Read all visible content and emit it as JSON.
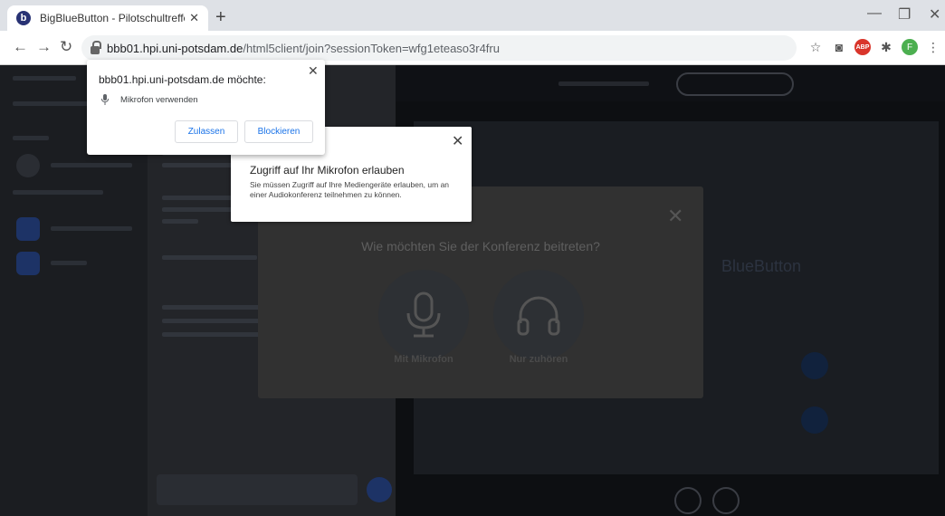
{
  "browser": {
    "tab_title": "BigBlueButton - Pilotschultreffen",
    "tab_favicon": "b",
    "url_host": "bbb01.hpi.uni-potsdam.de",
    "url_path": "/html5client/join?sessionToken=wfg1eteaso3r4fru",
    "profile_initial": "F",
    "abp_label": "ABP",
    "icons": [
      "back-icon",
      "forward-icon",
      "reload-icon",
      "lock-icon",
      "star-icon",
      "camera-icon",
      "adblock-icon",
      "puzzle-icon",
      "profile-icon",
      "menu-icon",
      "minimize-icon",
      "restore-icon",
      "close-icon"
    ]
  },
  "permission_prompt": {
    "title": "bbb01.hpi.uni-potsdam.de möchte:",
    "permission": "Mikrofon verwenden",
    "allow_label": "Zulassen",
    "block_label": "Blockieren"
  },
  "info_popup": {
    "title": "Zugriff auf Ihr Mikrofon erlauben",
    "body": "Sie müssen Zugriff auf Ihre Mediengeräte erlauben, um an einer Audiokonferenz teilnehmen zu können."
  },
  "audio_modal": {
    "title": "Wie möchten Sie der Konferenz beitreten?",
    "microphone_label": "Mit Mikrofon",
    "listen_only_label": "Nur zuhören"
  },
  "background": {
    "title_fragment": "BlueButton"
  },
  "colors": {
    "accent": "#1a73e8",
    "bbb_blue": "#283274",
    "abp_red": "#d9352b",
    "profile_green": "#4caf50"
  }
}
